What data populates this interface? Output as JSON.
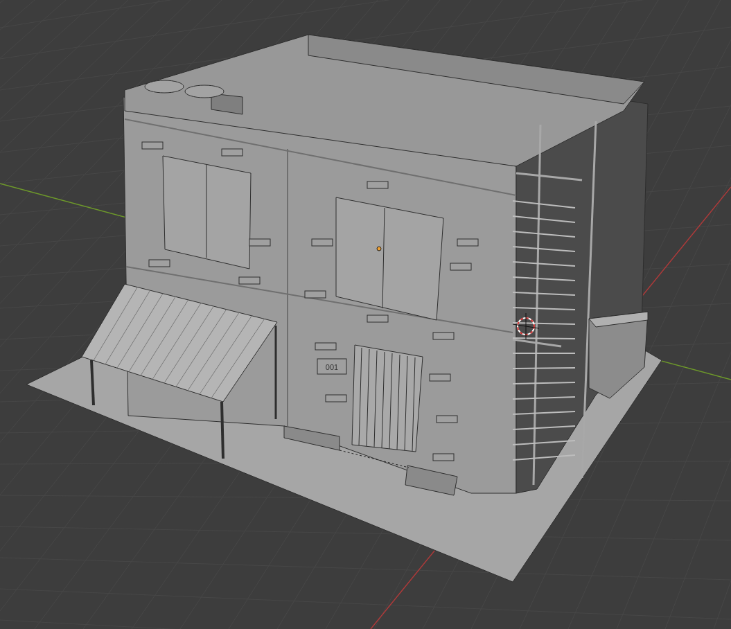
{
  "viewport": {
    "house_number": "001"
  }
}
